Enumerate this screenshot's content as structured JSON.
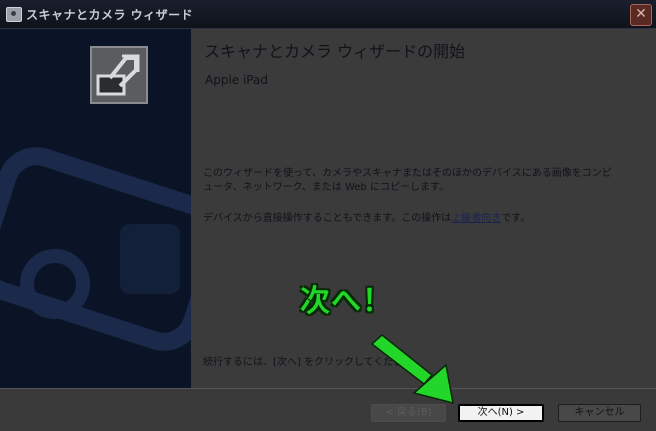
{
  "window": {
    "title": "スキャナとカメラ ウィザード"
  },
  "header": {
    "heading": "スキャナとカメラ ウィザードの開始",
    "device": "Apple iPad"
  },
  "body": {
    "description": "このウィザードを使って、カメラやスキャナまたはそのほかのデバイスにある画像をコンピュータ、ネットワーク、または Web にコピーします。",
    "advanced_prefix": "デバイスから直接操作することもできます。この操作は",
    "advanced_link": "上級者向き",
    "advanced_suffix": "です。",
    "continue_text": "続行するには、[次へ] をクリックしてください。"
  },
  "buttons": {
    "back": "< 戻る(B)",
    "next": "次へ(N) >",
    "cancel": "キャンセル"
  },
  "annotation": {
    "callout": "次へ！",
    "color": "#22d62a"
  },
  "icons": {
    "app": "scanner-camera-icon",
    "close": "close-icon",
    "wizard_logo": "wizard-logo-icon",
    "arrow": "green-arrow-icon"
  }
}
